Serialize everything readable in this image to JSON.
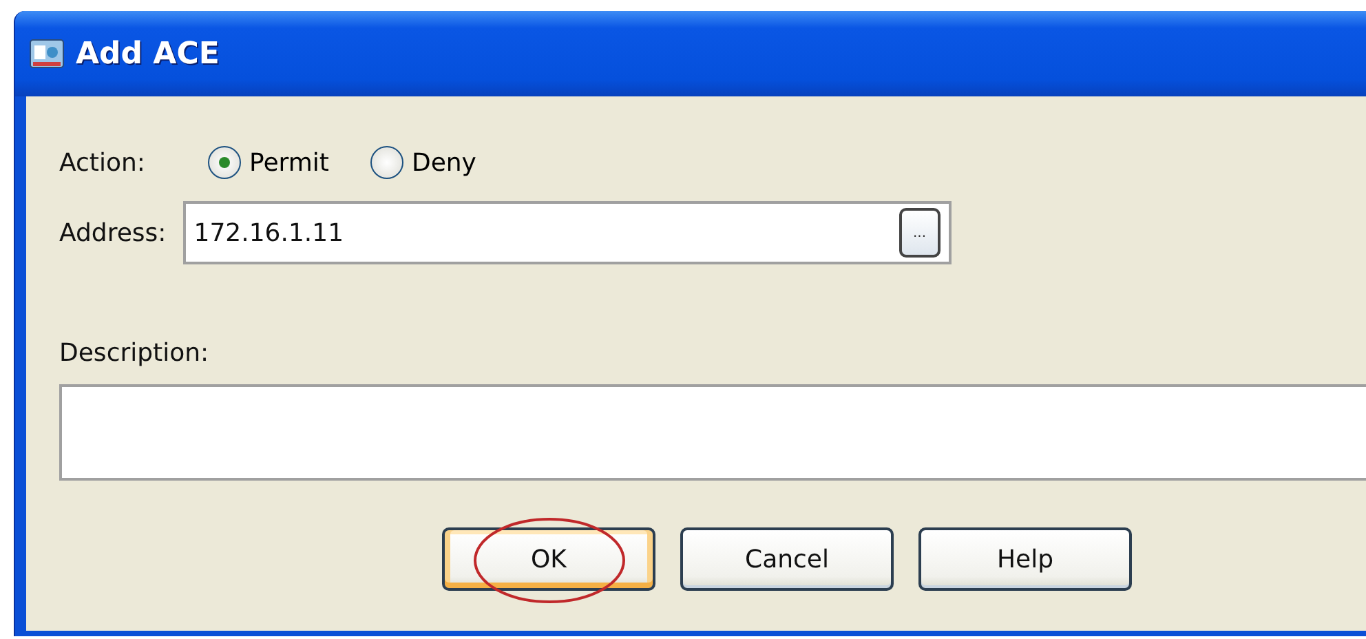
{
  "window": {
    "title": "Add ACE"
  },
  "action": {
    "label": "Action:",
    "options": [
      {
        "label": "Permit",
        "selected": true
      },
      {
        "label": "Deny",
        "selected": false
      }
    ]
  },
  "address": {
    "label": "Address:",
    "value": "172.16.1.11",
    "browse_button": "..."
  },
  "description": {
    "label": "Description:"
  },
  "buttons": [
    {
      "label": "OK",
      "default": true,
      "highlighted": true
    },
    {
      "label": "Cancel",
      "default": false,
      "highlighted": false
    },
    {
      "label": "Help",
      "default": false,
      "highlighted": false
    }
  ]
}
